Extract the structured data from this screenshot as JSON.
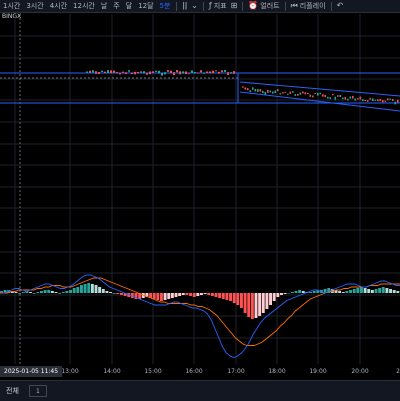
{
  "toolbar": {
    "timeframes": [
      {
        "label": "1시간",
        "active": false
      },
      {
        "label": "3시간",
        "active": false
      },
      {
        "label": "4시간",
        "active": false
      },
      {
        "label": "12시간",
        "active": false
      },
      {
        "label": "날",
        "active": false
      },
      {
        "label": "주",
        "active": false
      },
      {
        "label": "달",
        "active": false
      },
      {
        "label": "12달",
        "active": false
      },
      {
        "label": "5분",
        "active": true
      }
    ],
    "indicators_label": "지표",
    "alert_label": "얼러트",
    "replay_label": "리플레이"
  },
  "symbol": "BINGX",
  "time_axis": {
    "cursor_label": "2025-01-05 11:45",
    "ticks": [
      "13:00",
      "14:00",
      "15:00",
      "16:00",
      "17:00",
      "18:00",
      "19:00",
      "20:00",
      "2"
    ]
  },
  "bottom": {
    "all_label": "전체",
    "btn_label": "1"
  },
  "colors": {
    "up": "#26a69a",
    "down": "#ef5350",
    "macd": "#2962ff",
    "signal": "#ff6d00",
    "channel": "#2962ff",
    "hist_up_strong": "#26a69a",
    "hist_up_weak": "#b2dfdb",
    "hist_down_strong": "#ff5252",
    "hist_down_weak": "#ffcdd2"
  },
  "chart_data": {
    "type": "line",
    "macd_histogram": [
      2,
      3,
      3,
      2,
      1,
      0,
      1,
      2,
      1,
      0,
      1,
      2,
      3,
      3,
      2,
      1,
      0,
      1,
      2,
      3,
      5,
      6,
      8,
      9,
      10,
      9,
      8,
      6,
      4,
      2,
      1,
      0,
      -1,
      -2,
      -3,
      -4,
      -5,
      -6,
      -6,
      -5,
      -4,
      -5,
      -6,
      -7,
      -8,
      -7,
      -6,
      -5,
      -4,
      -3,
      -2,
      -2,
      -3,
      -4,
      -3,
      -2,
      -1,
      -2,
      -3,
      -4,
      -5,
      -6,
      -7,
      -8,
      -10,
      -12,
      -15,
      -20,
      -24,
      -26,
      -25,
      -23,
      -20,
      -16,
      -12,
      -8,
      -4,
      -2,
      -1,
      0,
      1,
      2,
      3,
      2,
      1,
      1,
      2,
      3,
      3,
      4,
      5,
      4,
      3,
      2,
      1,
      2,
      3,
      4,
      5,
      6,
      5,
      4,
      3,
      4,
      5,
      6,
      5,
      4,
      3,
      2
    ],
    "macd_line": [
      1,
      0,
      1,
      2,
      3,
      3,
      2,
      1,
      2,
      3,
      4,
      5,
      6,
      6,
      5,
      4,
      3,
      3,
      4,
      5,
      7,
      9,
      11,
      12,
      12,
      11,
      10,
      8,
      6,
      4,
      3,
      2,
      1,
      0,
      -1,
      -2,
      -3,
      -4,
      -5,
      -6,
      -7,
      -8,
      -8,
      -8,
      -8,
      -7,
      -6,
      -6,
      -7,
      -8,
      -9,
      -10,
      -10,
      -11,
      -12,
      -14,
      -18,
      -24,
      -30,
      -36,
      -40,
      -42,
      -43,
      -42,
      -40,
      -37,
      -33,
      -28,
      -24,
      -20,
      -17,
      -15,
      -13,
      -11,
      -9,
      -7,
      -5,
      -4,
      -3,
      -2,
      -1,
      0,
      1,
      2,
      2,
      1,
      0,
      1,
      2,
      3,
      4,
      5,
      6,
      6,
      6,
      5,
      4,
      4,
      5,
      6,
      7,
      8,
      8,
      7,
      6,
      5,
      5
    ],
    "signal_line": [
      0,
      0,
      0,
      1,
      1,
      2,
      2,
      2,
      2,
      2,
      3,
      3,
      4,
      4,
      5,
      5,
      5,
      4,
      4,
      4,
      5,
      6,
      7,
      8,
      9,
      10,
      10,
      10,
      9,
      8,
      7,
      6,
      5,
      4,
      3,
      2,
      1,
      0,
      -1,
      -2,
      -3,
      -4,
      -5,
      -6,
      -6,
      -7,
      -7,
      -7,
      -7,
      -7,
      -7,
      -8,
      -8,
      -9,
      -9,
      -10,
      -11,
      -13,
      -15,
      -18,
      -21,
      -24,
      -27,
      -30,
      -32,
      -34,
      -35,
      -35,
      -35,
      -34,
      -33,
      -31,
      -29,
      -27,
      -25,
      -22,
      -20,
      -17,
      -15,
      -12,
      -10,
      -8,
      -6,
      -4,
      -3,
      -2,
      -1,
      0,
      1,
      1,
      2,
      2,
      3,
      3,
      4,
      4,
      4,
      4,
      4,
      5,
      5,
      5,
      6,
      6,
      6,
      6,
      6,
      6
    ]
  }
}
